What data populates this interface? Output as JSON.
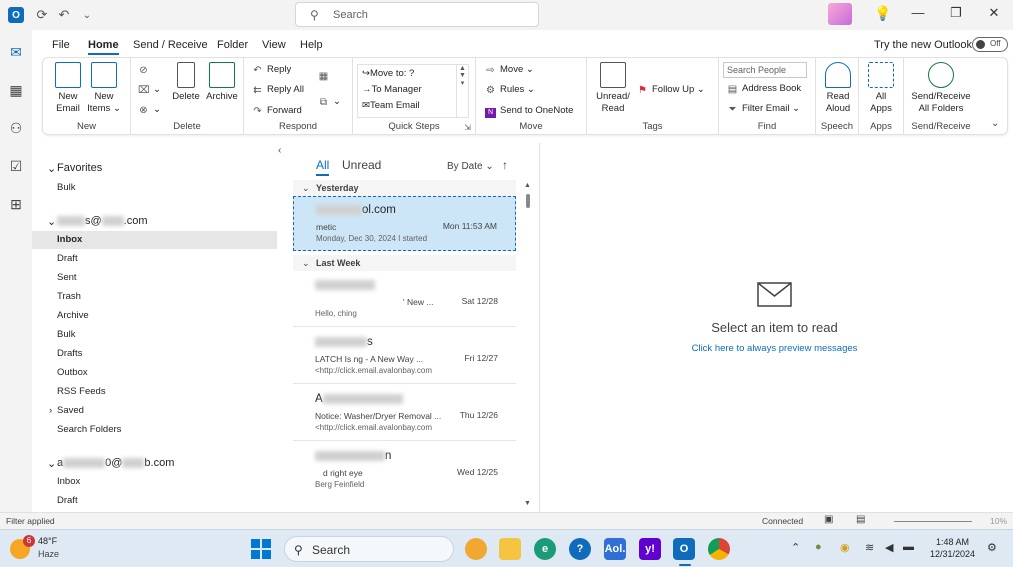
{
  "titlebar": {
    "search_placeholder": "Search",
    "controls": [
      "minimize",
      "restore",
      "close"
    ]
  },
  "menu": {
    "items": [
      "File",
      "Home",
      "Send / Receive",
      "Folder",
      "View",
      "Help"
    ],
    "active": "Home",
    "try_new": "Try the new Outlook",
    "toggle": "Off"
  },
  "ribbon": {
    "new": {
      "label": "New",
      "new_email": "New\nEmail",
      "new_email_1": "New",
      "new_email_2": "Email",
      "new_items_1": "New",
      "new_items_2": "Items ⌄"
    },
    "delete": {
      "label": "Delete",
      "delete_btn": "Delete",
      "archive_btn": "Archive"
    },
    "respond": {
      "label": "Respond",
      "reply": "Reply",
      "reply_all": "Reply All",
      "forward": "Forward"
    },
    "quick_steps": {
      "label": "Quick Steps",
      "move_to": "Move to: ?",
      "to_manager": "To Manager",
      "team_email": "Team Email"
    },
    "move": {
      "label": "Move",
      "move": "Move ⌄",
      "rules": "Rules ⌄",
      "onenote": "Send to OneNote"
    },
    "tags": {
      "label": "Tags",
      "unread_read_1": "Unread/",
      "unread_read_2": "Read",
      "follow_up": "Follow Up ⌄"
    },
    "find": {
      "label": "Find",
      "search_people": "Search People",
      "address_book": "Address Book",
      "filter_email": "Filter Email ⌄"
    },
    "speech": {
      "label": "Speech",
      "read_aloud_1": "Read",
      "read_aloud_2": "Aloud"
    },
    "apps": {
      "label": "Apps",
      "all_apps_1": "All",
      "all_apps_2": "Apps"
    },
    "send_receive": {
      "label": "Send/Receive",
      "btn_1": "Send/Receive",
      "btn_2": "All Folders"
    }
  },
  "folders": {
    "favorites_label": "Favorites",
    "favorites": [
      "Bulk"
    ],
    "account1_suffix": "@",
    "account1_domain": ".com",
    "account1_folders": [
      "Inbox",
      "Draft",
      "Sent",
      "Trash",
      "Archive",
      "Bulk",
      "Drafts",
      "Outbox",
      "RSS Feeds",
      "Saved",
      "Search Folders"
    ],
    "account2_prefix": "a",
    "account2_mid": "0@",
    "account2_domain": "b.com",
    "account2_folders": [
      "Inbox",
      "Draft"
    ]
  },
  "message_list": {
    "tab_all": "All",
    "tab_unread": "Unread",
    "sort": "By Date",
    "groups": [
      {
        "name": "Yesterday",
        "messages": [
          {
            "from": "ol.com",
            "subject": "metic",
            "date": "Mon 11:53 AM",
            "preview": "Monday, Dec 30, 2024 I started",
            "selected": true
          }
        ]
      },
      {
        "name": "Last Week",
        "messages": [
          {
            "from": "",
            "subject": "' New ...",
            "date": "Sat 12/28",
            "preview": "Hello, ching",
            "selected": false
          },
          {
            "from": "s",
            "subject": "LATCH Is ng - A New Way ...",
            "date": "Fri 12/27",
            "preview": "<http://click.email.avalonbay.com",
            "selected": false
          },
          {
            "from": "A",
            "subject": "Notice: Washer/Dryer Removal ...",
            "date": "Thu 12/26",
            "preview": "<http://click.email.avalonbay.com",
            "selected": false
          },
          {
            "from": "n",
            "subject": "d right eye",
            "date": "Wed 12/25",
            "preview": "Berg Feinfield",
            "selected": false
          }
        ]
      }
    ]
  },
  "reading_pane": {
    "title": "Select an item to read",
    "link": "Click here to always preview messages"
  },
  "statusbar": {
    "left": "Filter applied",
    "connection": "Connected",
    "zoom": "10%"
  },
  "taskbar": {
    "weather_temp": "48°F",
    "weather_cond": "Haze",
    "weather_badge": "6",
    "search_label": "Search",
    "time": "1:48 AM",
    "date": "12/31/2024",
    "pinned": [
      "start",
      "search",
      "widgets",
      "file-explorer",
      "edge",
      "help",
      "aol",
      "yahoo",
      "outlook",
      "chrome"
    ]
  }
}
